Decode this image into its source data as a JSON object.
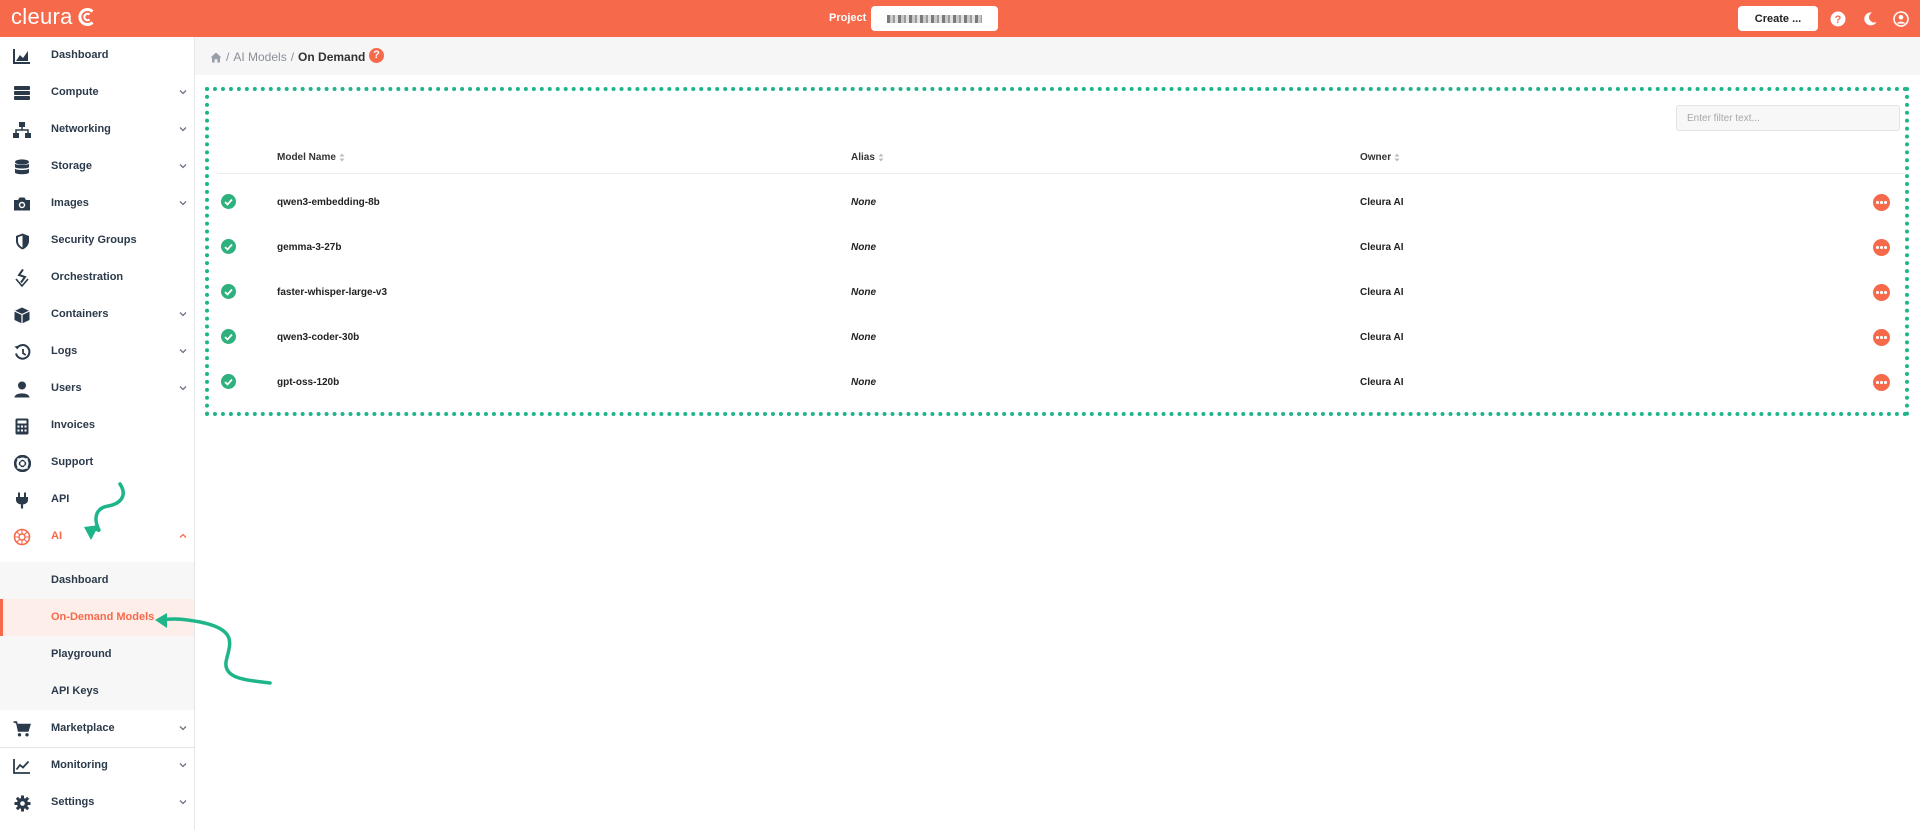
{
  "app": {
    "logo_text": "cleura"
  },
  "topbar": {
    "project_label": "Project",
    "create_label": "Create ...",
    "icons": [
      "help-icon",
      "moon-icon",
      "user-icon"
    ]
  },
  "sidebar": {
    "items": [
      {
        "label": "Dashboard",
        "icon": "chart-icon",
        "chevron": false
      },
      {
        "label": "Compute",
        "icon": "server-icon",
        "chevron": true
      },
      {
        "label": "Networking",
        "icon": "network-icon",
        "chevron": true
      },
      {
        "label": "Storage",
        "icon": "database-icon",
        "chevron": true
      },
      {
        "label": "Images",
        "icon": "camera-icon",
        "chevron": true
      },
      {
        "label": "Security Groups",
        "icon": "shield-icon",
        "chevron": false
      },
      {
        "label": "Orchestration",
        "icon": "layers-icon",
        "chevron": false
      },
      {
        "label": "Containers",
        "icon": "cube-icon",
        "chevron": true
      },
      {
        "label": "Logs",
        "icon": "history-icon",
        "chevron": true
      },
      {
        "label": "Users",
        "icon": "user-icon",
        "chevron": true
      },
      {
        "label": "Invoices",
        "icon": "calculator-icon",
        "chevron": false
      },
      {
        "label": "Support",
        "icon": "lifebuoy-icon",
        "chevron": false
      },
      {
        "label": "API",
        "icon": "plug-icon",
        "chevron": false
      },
      {
        "label": "AI",
        "icon": "ai-icon",
        "chevron": true,
        "expanded": true
      }
    ],
    "ai_subitems": [
      {
        "label": "Dashboard"
      },
      {
        "label": "On-Demand Models",
        "active": true
      },
      {
        "label": "Playground"
      },
      {
        "label": "API Keys"
      }
    ],
    "bottom_items": [
      {
        "label": "Marketplace",
        "icon": "cart-icon",
        "chevron": true
      },
      {
        "label": "Monitoring",
        "icon": "line-chart-icon",
        "chevron": true
      },
      {
        "label": "Settings",
        "icon": "gear-icon",
        "chevron": true
      }
    ]
  },
  "breadcrumb": {
    "parent": "AI Models",
    "separator": "/",
    "current": "On Demand"
  },
  "filter": {
    "placeholder": "Enter filter text..."
  },
  "table": {
    "columns": [
      "Model Name",
      "Alias",
      "Owner"
    ],
    "rows": [
      {
        "name": "qwen3-embedding-8b",
        "alias": "None",
        "owner": "Cleura AI",
        "status": "ok"
      },
      {
        "name": "gemma-3-27b",
        "alias": "None",
        "owner": "Cleura AI",
        "status": "ok"
      },
      {
        "name": "faster-whisper-large-v3",
        "alias": "None",
        "owner": "Cleura AI",
        "status": "ok"
      },
      {
        "name": "qwen3-coder-30b",
        "alias": "None",
        "owner": "Cleura AI",
        "status": "ok"
      },
      {
        "name": "gpt-oss-120b",
        "alias": "None",
        "owner": "Cleura AI",
        "status": "ok"
      }
    ]
  },
  "colors": {
    "brand": "#f6694b",
    "status_ok": "#2fb07d",
    "annotation": "#1fb58a",
    "sidebar_text": "#2b3a4a"
  }
}
